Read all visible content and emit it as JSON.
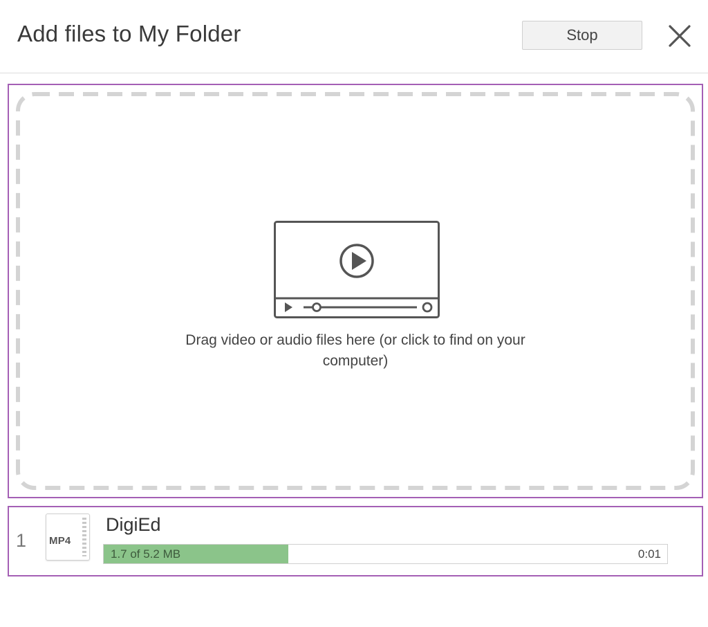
{
  "dialog": {
    "title": "Add files to My Folder",
    "stop_label": "Stop",
    "close_icon": "close-icon"
  },
  "dropzone": {
    "icon": "video-player-icon",
    "text": "Drag video or audio files here (or click to find on your computer)"
  },
  "uploads": [
    {
      "index": "1",
      "file_type": "MP4",
      "icon": "video-file-icon",
      "name": "DigiEd",
      "progress_text": "1.7 of 5.2 MB",
      "progress_fraction": 0.327,
      "elapsed": "0:01"
    }
  ],
  "colors": {
    "highlight": "#a45fb5",
    "progress_fill": "#8bc48a",
    "dash": "#d4d4d4"
  }
}
